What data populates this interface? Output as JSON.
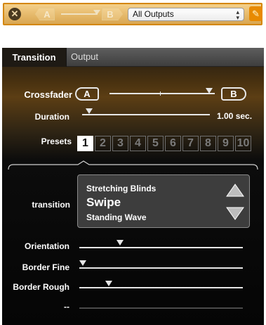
{
  "toolbar": {
    "a_label": "A",
    "b_label": "B",
    "output_select": "All Outputs",
    "accent": "#e88a00"
  },
  "tabs": [
    "Transition",
    "Output"
  ],
  "crossfader": {
    "label": "Crossfader",
    "a_label": "A",
    "b_label": "B",
    "position": 0.92
  },
  "duration": {
    "label": "Duration",
    "value": "1.00 sec.",
    "position": 0.06
  },
  "presets": {
    "label": "Presets",
    "items": [
      "1",
      "2",
      "3",
      "4",
      "5",
      "6",
      "7",
      "8",
      "9",
      "10"
    ],
    "selected": "1"
  },
  "transition": {
    "label": "transition",
    "previous": "Stretching Blinds",
    "current": "Swipe",
    "next": "Standing Wave"
  },
  "params": [
    {
      "label": "Orientation",
      "position": 0.25
    },
    {
      "label": "Border Fine",
      "position": 0.02
    },
    {
      "label": "Border Rough",
      "position": 0.18
    },
    {
      "label": "--",
      "position": null
    }
  ]
}
